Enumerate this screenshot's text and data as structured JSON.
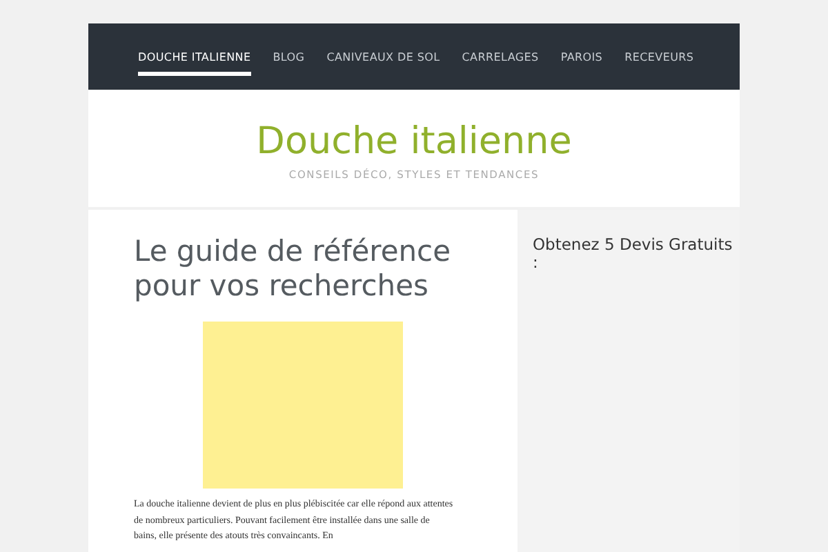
{
  "nav": [
    {
      "label": "DOUCHE ITALIENNE",
      "selected": true
    },
    {
      "label": "BLOG",
      "selected": false
    },
    {
      "label": "CANIVEAUX DE SOL",
      "selected": false
    },
    {
      "label": "CARRELAGES",
      "selected": false
    },
    {
      "label": "PAROIS",
      "selected": false
    },
    {
      "label": "RECEVEURS",
      "selected": false
    }
  ],
  "site": {
    "title": "Douche italienne",
    "tagline": "CONSEILS DÉCO, STYLES ET TENDANCES"
  },
  "article": {
    "title": "Le guide de référence pour vos recherches",
    "image": {
      "kind": "placeholder"
    },
    "body": "La douche italienne devient de plus en plus plébiscitée car elle répond aux attentes de nombreux particuliers. Pouvant facilement être installée dans une salle de bains, elle présente des atouts très convaincants. En"
  },
  "sidebar": {
    "heading": "Obtenez 5 Devis Gratuits :"
  }
}
